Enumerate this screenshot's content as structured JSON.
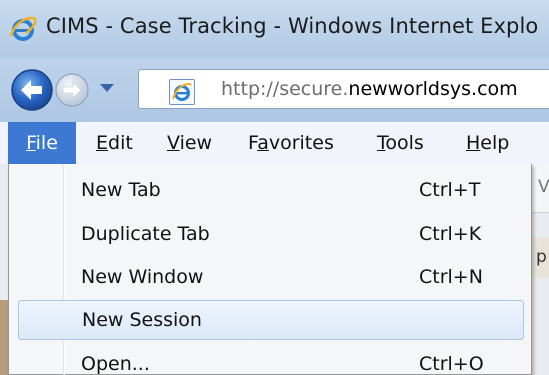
{
  "window": {
    "title": "CIMS - Case Tracking - Windows Internet Explo"
  },
  "address": {
    "scheme": "http://secure.",
    "domain": "newworldsys.com",
    "rest": ""
  },
  "menubar": {
    "items": [
      {
        "label": "File",
        "mnemonic": "F",
        "rest": "ile"
      },
      {
        "label": "Edit",
        "mnemonic": "E",
        "rest": "dit"
      },
      {
        "label": "View",
        "mnemonic": "V",
        "rest": "iew"
      },
      {
        "label": "Favorites",
        "pre": "F",
        "mnemonic": "a",
        "rest": "vorites"
      },
      {
        "label": "Tools",
        "mnemonic": "T",
        "rest": "ools"
      },
      {
        "label": "Help",
        "mnemonic": "H",
        "rest": "elp"
      }
    ]
  },
  "file_menu": {
    "items": [
      {
        "label": "New Tab",
        "shortcut": "Ctrl+T"
      },
      {
        "label": "Duplicate Tab",
        "shortcut": "Ctrl+K"
      },
      {
        "label": "New Window",
        "shortcut": "Ctrl+N"
      },
      {
        "label": "New Session",
        "shortcut": ""
      },
      {
        "label": "Open...",
        "shortcut": "Ctrl+O"
      }
    ]
  },
  "background": {
    "fragment1": "V",
    "fragment2": "p"
  },
  "colors": {
    "menu_active": "#3d79d2",
    "hover_border": "#a8c5ea"
  },
  "icons": {
    "ie_logo": "ie-logo-icon",
    "back": "back-arrow-icon",
    "forward": "forward-arrow-icon",
    "page": "page-icon"
  }
}
